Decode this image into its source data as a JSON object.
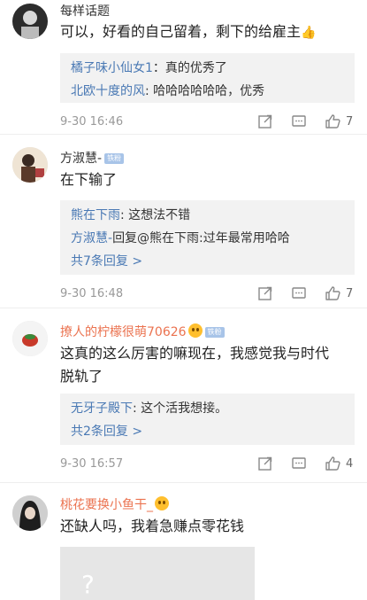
{
  "comments": [
    {
      "username": "每样话题",
      "text": "可以，好看的自己留着，剩下的给雇主",
      "replies": [
        {
          "name": "橘子味小仙女1",
          "text": "：真的优秀了"
        },
        {
          "name": "北欧十度的风",
          "text": ": 哈哈哈哈哈哈，优秀"
        }
      ],
      "timestamp": "9-30 16:46",
      "likes": "7"
    },
    {
      "username": "方淑慧-",
      "badge": "铁粉",
      "text": "在下输了",
      "replies": [
        {
          "name": "熊在下雨",
          "text": ": 这想法不错"
        },
        {
          "name": "方淑慧-",
          "text": "回复@熊在下雨:过年最常用哈哈"
        }
      ],
      "more_replies": "共7条回复 >",
      "timestamp": "9-30 16:48",
      "likes": "7"
    },
    {
      "username": "撩人的柠檬很萌70626",
      "badge": "铁粉",
      "text_line1": "这真的这么厉害的嘛现在，我感觉我与时代",
      "text_line2": "脱轨了",
      "replies": [
        {
          "name": "无牙子殿下",
          "text": ": 这个活我想接。"
        }
      ],
      "more_replies": "共2条回复 >",
      "timestamp": "9-30 16:57",
      "likes": "4"
    },
    {
      "username": "桃花要换小鱼干_",
      "text": "还缺人吗，我着急赚点零花钱"
    }
  ],
  "icons": {
    "share": "share-icon",
    "comment": "comment-icon",
    "like": "thumbs-up-icon"
  },
  "colors": {
    "link": "#4a79b4",
    "orange_name": "#eb7350",
    "badge": "#a8c4e8"
  }
}
